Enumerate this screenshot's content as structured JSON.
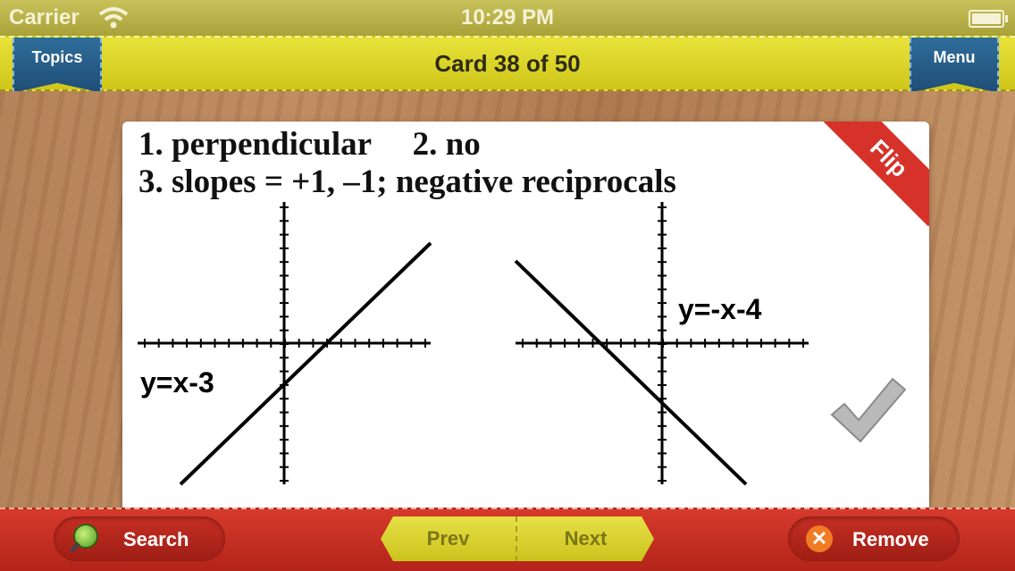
{
  "status_bar": {
    "carrier": "Carrier",
    "time": "10:29 PM"
  },
  "nav": {
    "title": "Card 38 of 50",
    "left_ribbon": "Topics",
    "right_ribbon": "Menu"
  },
  "card": {
    "line1": "1. perpendicular     2. no",
    "line2": "3. slopes = +1, –1; negative reciprocals",
    "flip_label": "Flip",
    "left_graph_label": "y=x-3",
    "right_graph_label": "y=-x-4",
    "check_icon": "checkmark-icon"
  },
  "bottom": {
    "search": "Search",
    "prev": "Prev",
    "next": "Next",
    "remove": "Remove"
  },
  "colors": {
    "nav_yellow": "#e0d92d",
    "ribbon_blue": "#2a5f8a",
    "bottom_red": "#c8301f",
    "flip_red": "#d6322a"
  }
}
